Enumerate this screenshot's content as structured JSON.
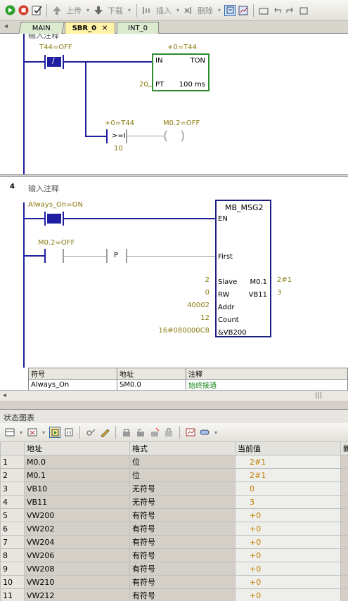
{
  "toolbar": {
    "upload_label": "上传",
    "download_label": "下载",
    "insert_label": "插入",
    "delete_label": "删除"
  },
  "tabs": [
    {
      "label": "MAIN"
    },
    {
      "label": "SBR_0"
    },
    {
      "label": "INT_0"
    }
  ],
  "network3": {
    "comment_partial": "输入注释",
    "contact_label": "T44=OFF",
    "timer_value": "+0=T44",
    "timer_type": "TON",
    "timer_in": "IN",
    "timer_pt_pin": "PT",
    "timer_pt_value": "20",
    "timer_base": "100 ms",
    "cmp_value": "+0=T44",
    "cmp_op": ">=I",
    "cmp_const": "10",
    "coil_label": "M0.2=OFF"
  },
  "network4": {
    "number": "4",
    "comment": "输入注释",
    "contact1_label": "Always_On=ON",
    "contact2_label": "M0.2=OFF",
    "edge_label": "P",
    "box_title": "MB_MSG2",
    "pins": {
      "en": "EN",
      "first": "First",
      "slave": "Slave",
      "rw": "RW",
      "addr": "Addr",
      "count": "Count",
      "dataptr": "&VB200"
    },
    "inputs": {
      "slave": "2",
      "rw": "0",
      "addr": "40002",
      "count": "12",
      "dataptr": "16#080000C8"
    },
    "outputs": [
      {
        "pin": "M0.1",
        "value": "2#1"
      },
      {
        "pin": "VB11",
        "value": "3"
      }
    ]
  },
  "symbol_table": {
    "headers": [
      "符号",
      "地址",
      "注释"
    ],
    "rows": [
      [
        "Always_On",
        "SM0.0",
        "始终接通"
      ]
    ]
  },
  "status_chart": {
    "title": "状态图表",
    "headers": [
      "",
      "地址",
      "格式",
      "当前值",
      "新"
    ],
    "rows": [
      [
        "1",
        "M0.0",
        "位",
        "2#1"
      ],
      [
        "2",
        "M0.1",
        "位",
        "2#1"
      ],
      [
        "3",
        "VB10",
        "无符号",
        "0"
      ],
      [
        "4",
        "VB11",
        "无符号",
        "3"
      ],
      [
        "5",
        "VW200",
        "有符号",
        "+0"
      ],
      [
        "6",
        "VW202",
        "有符号",
        "+0"
      ],
      [
        "7",
        "VW204",
        "有符号",
        "+0"
      ],
      [
        "8",
        "VW206",
        "有符号",
        "+0"
      ],
      [
        "9",
        "VW208",
        "有符号",
        "+0"
      ],
      [
        "10",
        "VW210",
        "有符号",
        "+0"
      ],
      [
        "11",
        "VW212",
        "有符号",
        "+0"
      ]
    ]
  },
  "colors": {
    "wire": "#1e1ea0",
    "active_tab": "#fff3a8",
    "timer_box": "#2e8b2e",
    "value_text": "#c08000"
  }
}
